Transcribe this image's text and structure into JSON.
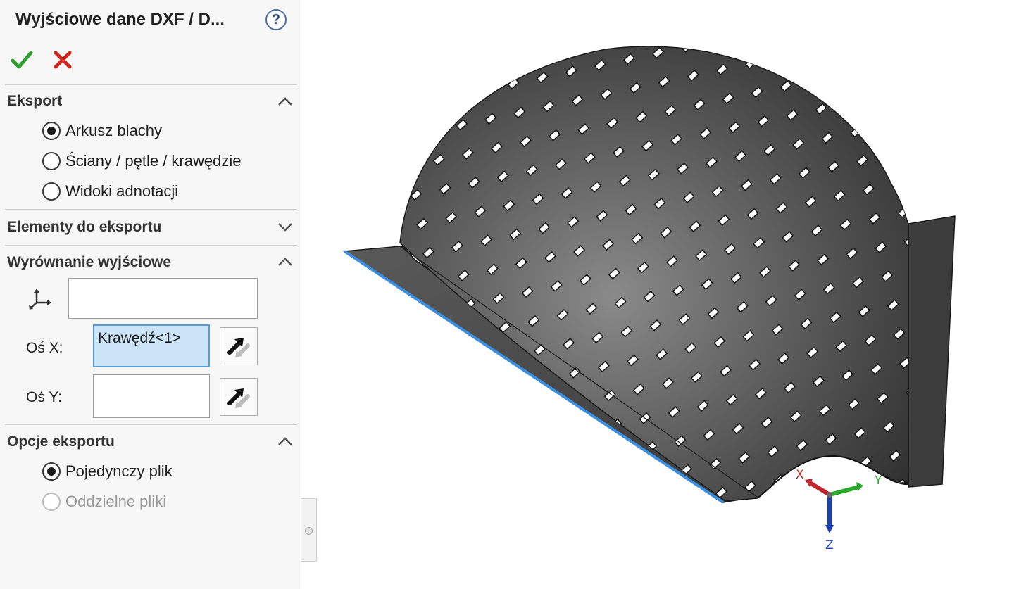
{
  "panel": {
    "title": "Wyjściowe dane DXF / D...",
    "help_icon": "help-icon",
    "ok_icon": "check-icon",
    "cancel_icon": "close-icon",
    "colors": {
      "ok": "#2e9e2e",
      "cancel": "#d0261c",
      "active_field": "#cce4f7"
    }
  },
  "sections": {
    "export": {
      "title": "Eksport",
      "options": [
        {
          "label": "Arkusz blachy",
          "checked": true,
          "enabled": true
        },
        {
          "label": "Ściany / pętle / krawędzie",
          "checked": false,
          "enabled": true
        },
        {
          "label": "Widoki adnotacji",
          "checked": false,
          "enabled": true
        }
      ]
    },
    "elements": {
      "title": "Elementy do eksportu",
      "expanded": false
    },
    "alignment": {
      "title": "Wyrównanie wyjściowe",
      "origin_icon": "coordinate-system-icon",
      "origin_value": "",
      "x_axis": {
        "label": "Oś X:",
        "value": "Krawędź<1>"
      },
      "y_axis": {
        "label": "Oś Y:",
        "value": ""
      }
    },
    "options": {
      "title": "Opcje eksportu",
      "options": [
        {
          "label": "Pojedynczy plik",
          "checked": true,
          "enabled": true
        },
        {
          "label": "Oddzielne pliki",
          "checked": false,
          "enabled": false
        }
      ]
    }
  },
  "viewport": {
    "triad": {
      "x_label": "X",
      "y_label": "Y",
      "z_label": "Z"
    },
    "colors": {
      "selected_edge": "#3a8fe0",
      "x": "#c0252a",
      "y": "#2aa82a",
      "z": "#1a3fb8"
    }
  }
}
